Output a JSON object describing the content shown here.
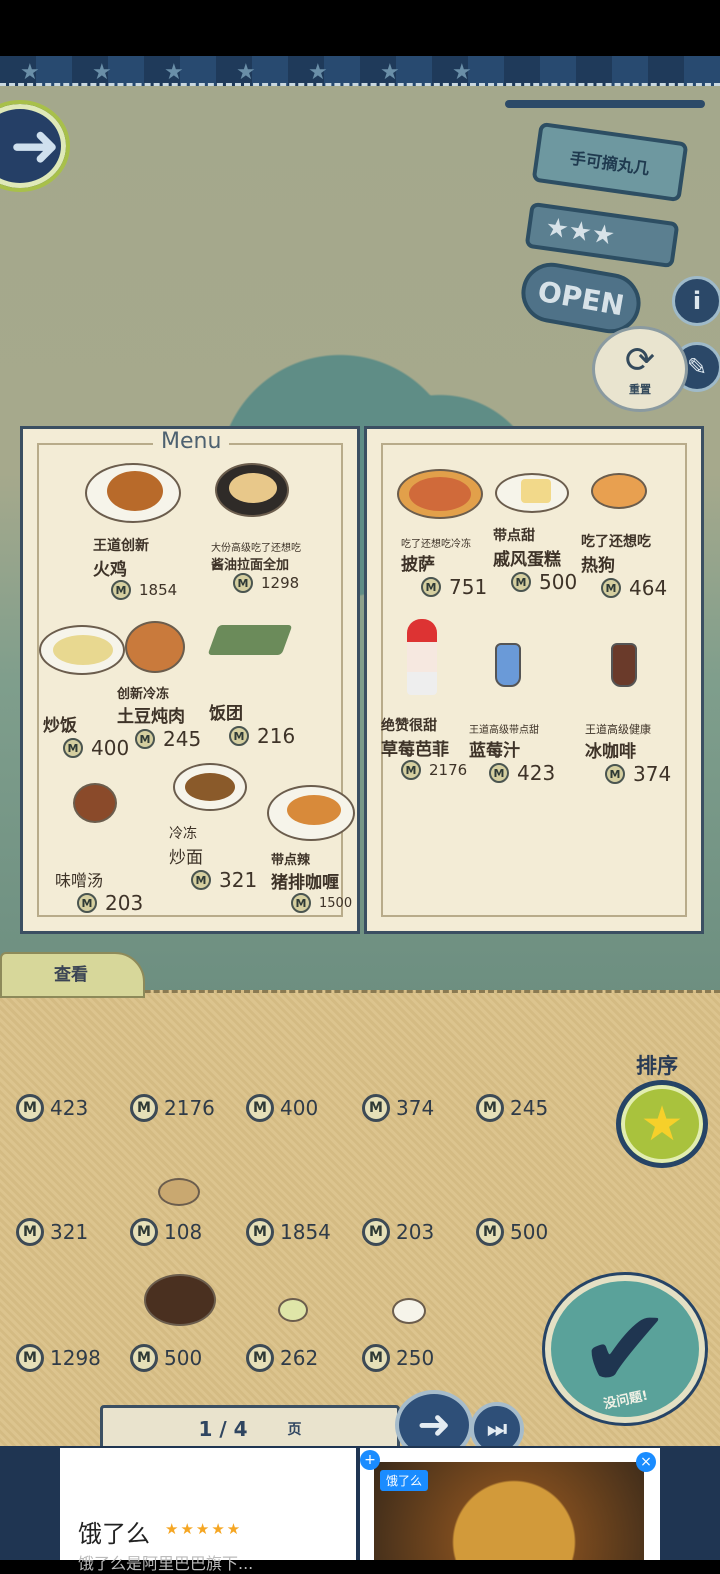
{
  "shop_sign": {
    "name": "手可摘丸几",
    "stars": "★★★",
    "status": "OPEN"
  },
  "reset": {
    "label": "重置"
  },
  "menu": {
    "title": "Menu",
    "left": [
      {
        "prefix": "王道创新",
        "name": "火鸡",
        "price": "1854"
      },
      {
        "prefix": "大份高级吃了还想吃",
        "name": "酱油拉面全加",
        "price": "1298"
      },
      {
        "prefix": "",
        "name": "炒饭",
        "price": "400"
      },
      {
        "prefix": "创新冷冻",
        "name": "土豆炖肉",
        "price": "245"
      },
      {
        "prefix": "",
        "name": "饭团",
        "price": "216"
      },
      {
        "prefix": "",
        "name": "味噌汤",
        "price": "203"
      },
      {
        "prefix": "冷冻",
        "name": "炒面",
        "price": "321"
      },
      {
        "prefix": "带点辣",
        "name": "猪排咖喱",
        "price": "1500"
      }
    ],
    "right": [
      {
        "prefix": "吃了还想吃冷冻",
        "name": "披萨",
        "price": "751"
      },
      {
        "prefix": "带点甜",
        "name": "戚风蛋糕",
        "price": "500"
      },
      {
        "prefix": "吃了还想吃",
        "name": "热狗",
        "price": "464"
      },
      {
        "prefix": "绝赞很甜",
        "name": "草莓芭菲",
        "price": "2176"
      },
      {
        "prefix": "王道高级带点甜",
        "name": "蓝莓汁",
        "price": "423"
      },
      {
        "prefix": "王道高级健康",
        "name": "冰咖啡",
        "price": "374"
      }
    ]
  },
  "view_tab": "查看",
  "sort_label": "排序",
  "coin_symbol": "M",
  "inventory": {
    "row1": [
      "423",
      "2176",
      "400",
      "374",
      "245"
    ],
    "row2": [
      "321",
      "108",
      "1854",
      "203",
      "500"
    ],
    "row3": [
      "1298",
      "500",
      "262",
      "250"
    ]
  },
  "confirm_label": "没问题!",
  "pager": {
    "page": "1 / 4",
    "unit": "页"
  },
  "ad": {
    "title": "饿了么",
    "stars": "★★★★★",
    "subtitle": "饿了么是阿里巴巴旗下...",
    "logo": "饿了么"
  },
  "colors": {
    "accent": "#264466",
    "panel": "#dcc48e",
    "menu_paper": "#f3ecd6"
  }
}
